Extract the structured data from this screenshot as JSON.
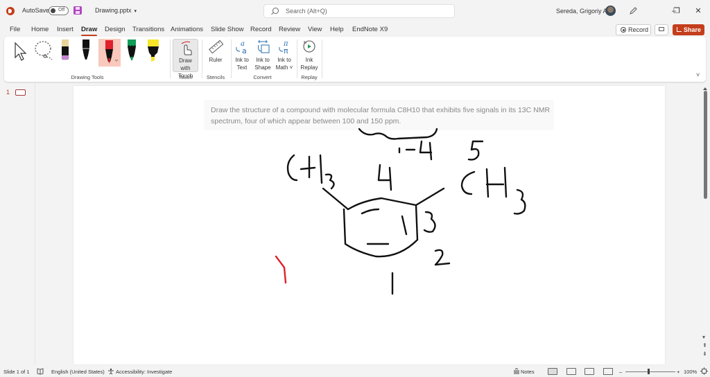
{
  "titlebar": {
    "autosave_label": "AutoSave",
    "autosave_state": "Off",
    "doc_title": "Drawing.pptx",
    "doc_caret": "▾",
    "search_placeholder": "Search (Alt+Q)",
    "user_name": "Sereda, Grigoriy A",
    "minimize": "–",
    "restore": "❐",
    "close": "✕"
  },
  "menu": {
    "tabs": [
      {
        "label": "File"
      },
      {
        "label": "Home"
      },
      {
        "label": "Insert"
      },
      {
        "label": "Draw",
        "active": true
      },
      {
        "label": "Design"
      },
      {
        "label": "Transitions"
      },
      {
        "label": "Animations"
      },
      {
        "label": "Slide Show"
      },
      {
        "label": "Record"
      },
      {
        "label": "Review"
      },
      {
        "label": "View"
      },
      {
        "label": "Help"
      },
      {
        "label": "EndNote X9"
      }
    ],
    "record_label": "Record",
    "share_label": "Share"
  },
  "ribbon": {
    "groups": {
      "drawing_tools": "Drawing Tools",
      "touch": "Touch",
      "stencils": "Stencils",
      "convert": "Convert",
      "replay": "Replay"
    },
    "draw_with_touch": "Draw with Touch",
    "ruler": "Ruler",
    "ink_to_text": "Ink to Text",
    "ink_to_shape": "Ink to Shape",
    "ink_to_math": "Ink to Math ˅",
    "ink_replay": "Ink Replay",
    "pens": [
      {
        "name": "select",
        "color": "#333333"
      },
      {
        "name": "lasso",
        "color": "#333333"
      },
      {
        "name": "eraser",
        "color": "#e9d39a",
        "band": "#c983d8"
      },
      {
        "name": "black-pen",
        "color": "#111111"
      },
      {
        "name": "red-pen",
        "color": "#e0202a",
        "selected": true
      },
      {
        "name": "green-pen",
        "color": "#0f9d58"
      },
      {
        "name": "yellow-highlighter",
        "color": "#f5e629"
      }
    ],
    "accent_selected_bg": "#f8c9bc"
  },
  "slides_pane": {
    "slide_number": "1"
  },
  "slide": {
    "prompt": "Draw the structure of a compound with molecular formula C8H10 that exhibits five signals in its 13C NMR spectrum, four of which appear between 100 and 150 ppm.",
    "ink_labels": {
      "left_group": "CH3",
      "right_group": "CH3",
      "range": "1-4",
      "five": "5",
      "four": "4",
      "three": "3",
      "two": "2",
      "one": "1",
      "checkmark": "V"
    },
    "ink_color": "#111111",
    "check_color": "#e0202a"
  },
  "statusbar": {
    "slide_info": "Slide 1 of 1",
    "language": "English (United States)",
    "accessibility": "Accessibility: Investigate",
    "notes": "Notes",
    "zoom_level": "100%",
    "zoom_minus": "–",
    "zoom_plus": "+"
  }
}
